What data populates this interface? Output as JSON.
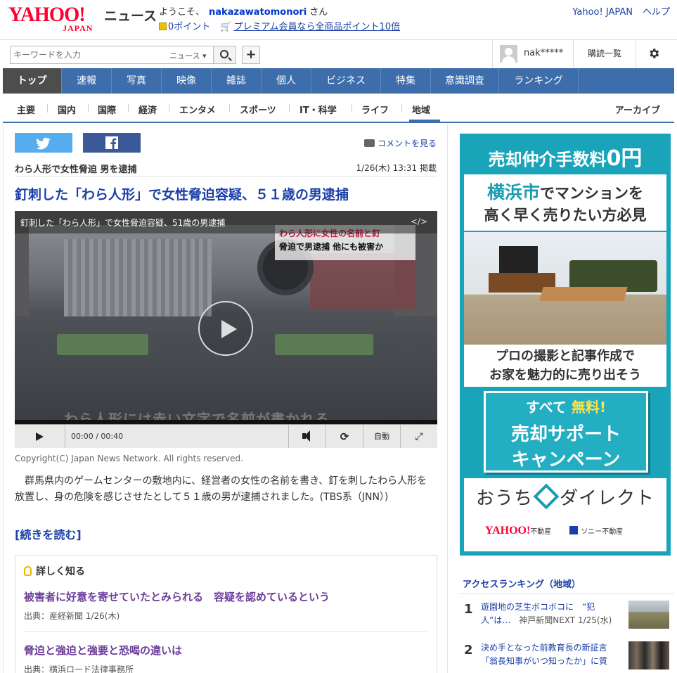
{
  "header": {
    "logo_text": "YAHOO!",
    "logo_sub": "JAPAN",
    "service": "ニュース",
    "welcome_prefix": "ようこそ、",
    "username": "nakazawatomonori",
    "welcome_suffix": "さん",
    "points": "0ポイント",
    "premium": "プレミアム会員なら全商品ポイント10倍",
    "links": [
      "Yahoo! JAPAN",
      "ヘルプ"
    ]
  },
  "search": {
    "placeholder": "キーワードを入力",
    "scope": "ニュース ▾",
    "add_label": "+"
  },
  "user": {
    "name": "nak*****",
    "reading_list": "購読一覧"
  },
  "main_nav": [
    "トップ",
    "速報",
    "写真",
    "映像",
    "雑誌",
    "個人",
    "ビジネス",
    "特集",
    "意識調査",
    "ランキング"
  ],
  "sub_nav": [
    "主要",
    "国内",
    "国際",
    "経済",
    "エンタメ",
    "スポーツ",
    "IT・科学",
    "ライフ",
    "地域"
  ],
  "archive": "アーカイブ",
  "article": {
    "comment_link": "コメントを見る",
    "sub_headline": "わら人形で女性脅迫 男を逮捕",
    "posted": "1/26(木) 13:31 掲載",
    "headline": "釘刺した「わら人形」で女性脅迫容疑、５１歳の男逮捕",
    "video": {
      "title": "釘刺した「わら人形」で女性脅迫容疑、51歳の男逮捕",
      "embed": "</>",
      "caption_l1": "わら人形に女性の名前と釘",
      "caption_l2": "脅迫で男逮捕 他にも被害か",
      "subtitle": "わら人形には赤い文字で名前が書かれる",
      "time": "00:00 / 00:40",
      "quality": "⟳",
      "auto": "自動",
      "fullscreen": "⤢"
    },
    "copyright": "Copyright(C) Japan News Network. All rights reserved.",
    "body": "群馬県内のゲームセンターの敷地内に、経営者の女性の名前を書き、釘を刺したわら人形を放置し、身の危険を感じさせたとして５１歳の男が逮捕されました。(TBS系（JNN）)",
    "read_more": "[続きを読む]"
  },
  "learn_more": {
    "title": "詳しく知る",
    "items": [
      {
        "title": "被害者に好意を寄せていたとみられる　容疑を認めているという",
        "source": "出典：産経新聞 1/26(木)"
      },
      {
        "title": "脅迫と強迫と強要と恐喝の違いは",
        "source": "出典：横浜ロード法律事務所"
      }
    ]
  },
  "ad": {
    "top": "売却仲介手数料",
    "zero": "0円",
    "city": "横浜市",
    "line1_rest": "でマンションを",
    "line2": "高く早く売りたい方必見",
    "line3": "プロの撮影と記事作成で",
    "line4": "お家を魅力的に売り出そう",
    "cta_all": "すべて",
    "cta_free": "無料!",
    "cta2": "売却サポート",
    "cta3": "キャンペーン",
    "brand_left": "おうち",
    "brand_right": "ダイレクト",
    "sponsor1": "YAHOO!",
    "sponsor1_sub": "不動産",
    "sponsor2": "ソニー不動産"
  },
  "ranking": {
    "title": "アクセスランキング（地域）",
    "items": [
      {
        "rank": "1",
        "title": "遊園地の芝生ボコボコに　“犯人”は…",
        "source": "神戸新聞NEXT 1/25(水)"
      },
      {
        "rank": "2",
        "title": "決め手となった前教育長の新証言「翁長知事がいつ知ったか」に質",
        "source": ""
      }
    ]
  },
  "colors": {
    "nav_blue": "#3d6daa",
    "nav_active": "#4d4d4d",
    "link_blue": "#1a3fa8",
    "ad_teal": "#19a4b9",
    "yahoo_red": "#ff0033"
  }
}
